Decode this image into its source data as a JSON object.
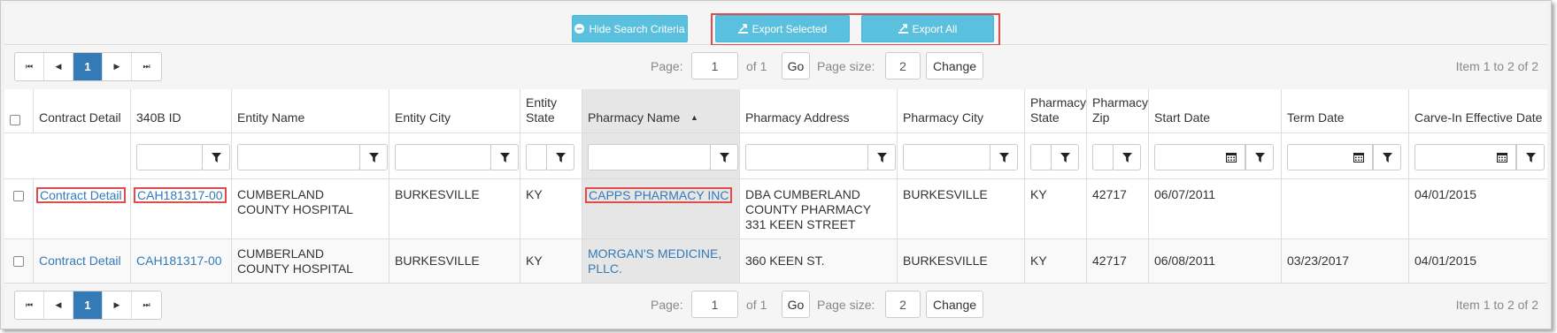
{
  "toolbar": {
    "hide_label": "Hide Search Criteria",
    "export_selected_label": "Export Selected",
    "export_all_label": "Export All",
    "accent_color": "#5bc0de"
  },
  "pager": {
    "first_icon": "first-page-icon",
    "prev_icon": "prev-page-icon",
    "current_page": "1",
    "next_icon": "next-page-icon",
    "last_icon": "last-page-icon",
    "page_label": "Page:",
    "page_value": "1",
    "of_label": "of 1",
    "go_label": "Go",
    "size_label": "Page size:",
    "size_value": "2",
    "change_label": "Change",
    "info": "Item 1 to 2 of 2"
  },
  "columns": [
    "Contract Detail",
    "340B ID",
    "Entity Name",
    "Entity City",
    "Entity State",
    "Pharmacy Name",
    "Pharmacy Address",
    "Pharmacy City",
    "Pharmacy State",
    "Pharmacy Zip",
    "Start Date",
    "Term Date",
    "Carve-In Effective Date"
  ],
  "sort_indicator": "▲",
  "rows": [
    {
      "contract": "Contract Detail",
      "id": "CAH181317-00",
      "entity_name": "CUMBERLAND COUNTY HOSPITAL",
      "entity_city": "BURKESVILLE",
      "entity_state": "KY",
      "pharmacy_name": "CAPPS PHARMACY INC",
      "pharmacy_address": "DBA CUMBERLAND COUNTY PHARMACY 331 KEEN STREET",
      "pharmacy_city": "BURKESVILLE",
      "pharmacy_state": "KY",
      "pharmacy_zip": "42717",
      "start_date": "06/07/2011",
      "term_date": "",
      "carve_in": "04/01/2015"
    },
    {
      "contract": "Contract Detail",
      "id": "CAH181317-00",
      "entity_name": "CUMBERLAND COUNTY HOSPITAL",
      "entity_city": "BURKESVILLE",
      "entity_state": "KY",
      "pharmacy_name": "MORGAN'S MEDICINE, PLLC.",
      "pharmacy_address": "360 KEEN ST.",
      "pharmacy_city": "BURKESVILLE",
      "pharmacy_state": "KY",
      "pharmacy_zip": "42717",
      "start_date": "06/08/2011",
      "term_date": "03/23/2017",
      "carve_in": "04/01/2015"
    }
  ]
}
